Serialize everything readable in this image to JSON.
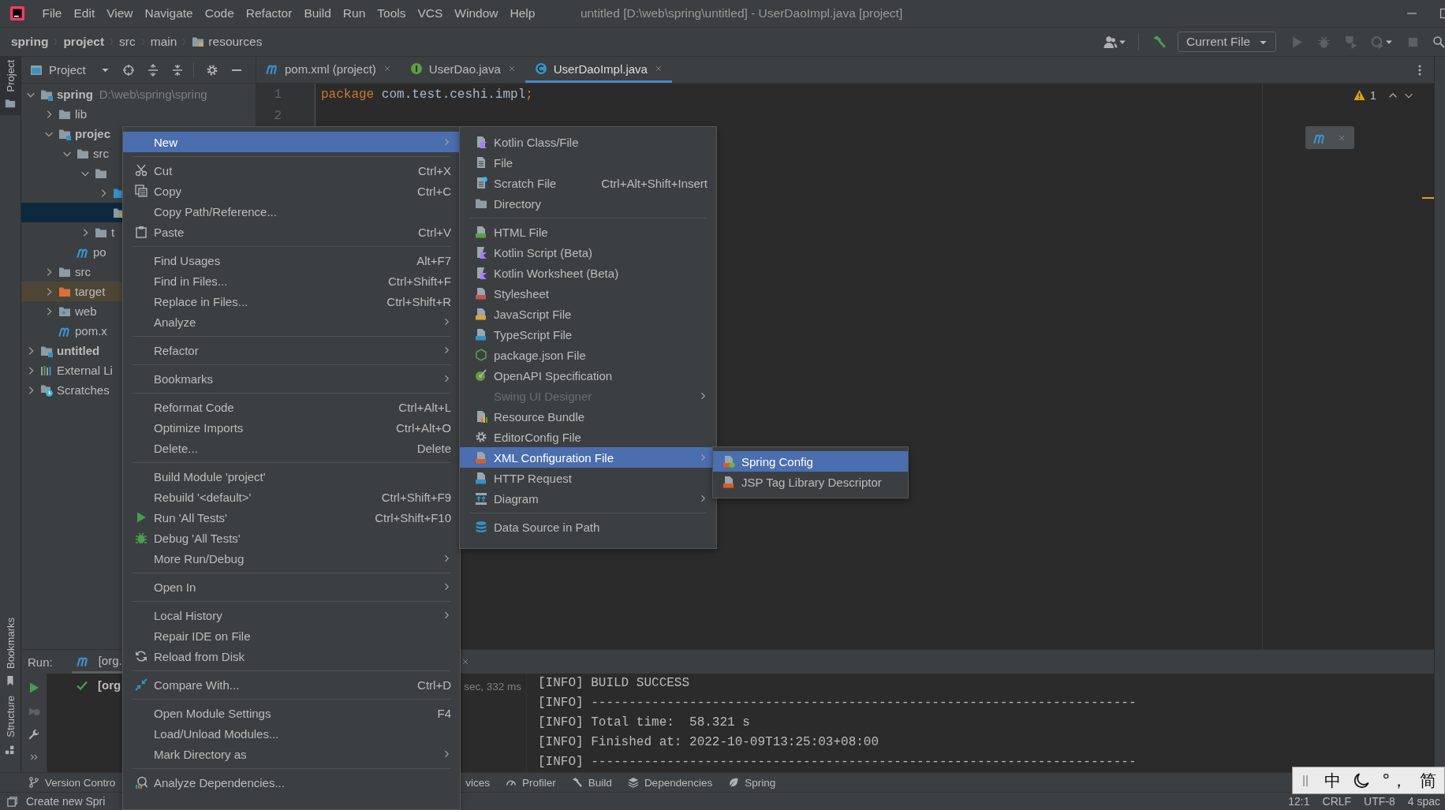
{
  "title_bar": {
    "menus": [
      "File",
      "Edit",
      "View",
      "Navigate",
      "Code",
      "Refactor",
      "Build",
      "Run",
      "Tools",
      "VCS",
      "Window",
      "Help"
    ],
    "title": "untitled [D:\\web\\spring\\untitled] - UserDaoImpl.java [project]"
  },
  "navigation_bar": {
    "breadcrumbs": [
      {
        "text": "spring",
        "bold": true
      },
      {
        "text": "project",
        "bold": true
      },
      {
        "text": "src",
        "bold": false
      },
      {
        "text": "main",
        "bold": false
      },
      {
        "text": "resources",
        "bold": false
      }
    ],
    "run_configuration": "Current File"
  },
  "left_stripe": [
    {
      "label": "Project",
      "selected": true
    },
    {
      "label": "Bookmarks",
      "selected": false
    },
    {
      "label": "Structure",
      "selected": false
    }
  ],
  "project_panel": {
    "title": "Project",
    "tree": [
      {
        "label": "spring",
        "path": "D:\\web\\spring\\spring",
        "kind": "module",
        "expanded": true,
        "selected": false,
        "children": [
          {
            "label": "lib",
            "kind": "folder",
            "expanded": false,
            "selected": false
          },
          {
            "label": "projec",
            "kind": "module",
            "expanded": true,
            "selected": false,
            "children": [
              {
                "label": "src",
                "kind": "folder",
                "expanded": true,
                "selected": false,
                "children": [
                  {
                    "kind": "folder",
                    "expanded": true,
                    "selected": false,
                    "children": [
                      {
                        "kind": "source-folder",
                        "expanded": false,
                        "selected": false
                      },
                      {
                        "kind": "resource-folder",
                        "selected": true
                      }
                    ]
                  },
                  {
                    "label": "t",
                    "kind": "folder",
                    "expanded": false,
                    "selected": false
                  }
                ]
              },
              {
                "label": "po",
                "kind": "maven",
                "selected": false
              }
            ]
          },
          {
            "label": "src",
            "kind": "folder",
            "expanded": false,
            "selected": false
          },
          {
            "label": "target",
            "kind": "excluded-folder",
            "expanded": false,
            "selected": false
          },
          {
            "label": "web",
            "kind": "web-folder",
            "expanded": false,
            "selected": false
          },
          {
            "label": "pom.x",
            "kind": "maven",
            "selected": false
          }
        ]
      },
      {
        "label": "untitled",
        "kind": "module",
        "expanded": false,
        "selected": false
      },
      {
        "label": "External Li",
        "kind": "library",
        "expanded": false,
        "selected": false
      },
      {
        "label": "Scratches",
        "kind": "scratch",
        "expanded": false,
        "selected": false
      }
    ]
  },
  "editor_tabs": [
    {
      "label": "pom.xml (project)",
      "kind": "maven",
      "selected": false
    },
    {
      "label": "UserDao.java",
      "kind": "interface",
      "selected": false
    },
    {
      "label": "UserDaoImpl.java",
      "kind": "class",
      "selected": true
    }
  ],
  "editor": {
    "lines": [
      {
        "number": "1",
        "tokens": [
          {
            "kind": "keyword",
            "text": "package"
          },
          {
            "kind": "plain",
            "text": " com.test.ceshi.impl"
          },
          {
            "kind": "keyword",
            "text": ";"
          }
        ]
      },
      {
        "number": "2"
      }
    ],
    "warnings": "1"
  },
  "run_panel": {
    "label": "Run:",
    "tab": "[org.",
    "tree_item": "[org",
    "duration": "sec, 332 ms",
    "console": [
      "[INFO] BUILD SUCCESS",
      "[INFO] ------------------------------------------------------------------------",
      "[INFO] Total time:  58.321 s",
      "[INFO] Finished at: 2022-10-09T13:25:03+08:00",
      "[INFO] ------------------------------------------------------------------------"
    ]
  },
  "tool_strip": [
    {
      "label": "Version Contro"
    },
    {
      "label": "vices"
    },
    {
      "label": "Profiler"
    },
    {
      "label": "Build"
    },
    {
      "label": "Dependencies"
    },
    {
      "label": "Spring"
    }
  ],
  "status_bar": {
    "message": "Create new Spri",
    "position": "12:1",
    "line_separator": "CRLF",
    "encoding": "UTF-8",
    "indent": "4 spac"
  },
  "context_menu": {
    "items": [
      {
        "kind": "item",
        "label": "New",
        "submenu": true,
        "selected": true
      },
      {
        "kind": "separator"
      },
      {
        "kind": "item",
        "label": "Cut",
        "shortcut": "Ctrl+X",
        "submenu": false,
        "selected": false
      },
      {
        "kind": "item",
        "label": "Copy",
        "shortcut": "Ctrl+C",
        "submenu": false,
        "selected": false
      },
      {
        "kind": "item",
        "label": "Copy Path/Reference...",
        "submenu": false,
        "selected": false
      },
      {
        "kind": "item",
        "label": "Paste",
        "shortcut": "Ctrl+V",
        "submenu": false,
        "selected": false
      },
      {
        "kind": "separator"
      },
      {
        "kind": "item",
        "label": "Find Usages",
        "shortcut": "Alt+F7",
        "submenu": false,
        "selected": false
      },
      {
        "kind": "item",
        "label": "Find in Files...",
        "shortcut": "Ctrl+Shift+F",
        "submenu": false,
        "selected": false
      },
      {
        "kind": "item",
        "label": "Replace in Files...",
        "shortcut": "Ctrl+Shift+R",
        "submenu": false,
        "selected": false
      },
      {
        "kind": "item",
        "label": "Analyze",
        "submenu": true,
        "selected": false
      },
      {
        "kind": "separator"
      },
      {
        "kind": "item",
        "label": "Refactor",
        "submenu": true,
        "selected": false
      },
      {
        "kind": "separator"
      },
      {
        "kind": "item",
        "label": "Bookmarks",
        "submenu": true,
        "selected": false
      },
      {
        "kind": "separator"
      },
      {
        "kind": "item",
        "label": "Reformat Code",
        "shortcut": "Ctrl+Alt+L",
        "submenu": false,
        "selected": false
      },
      {
        "kind": "item",
        "label": "Optimize Imports",
        "shortcut": "Ctrl+Alt+O",
        "submenu": false,
        "selected": false
      },
      {
        "kind": "item",
        "label": "Delete...",
        "shortcut": "Delete",
        "submenu": false,
        "selected": false
      },
      {
        "kind": "separator"
      },
      {
        "kind": "item",
        "label": "Build Module 'project'",
        "submenu": false,
        "selected": false
      },
      {
        "kind": "item",
        "label": "Rebuild '<default>'",
        "shortcut": "Ctrl+Shift+F9",
        "submenu": false,
        "selected": false
      },
      {
        "kind": "item",
        "label": "Run 'All Tests'",
        "shortcut": "Ctrl+Shift+F10",
        "submenu": false,
        "selected": false
      },
      {
        "kind": "item",
        "label": "Debug 'All Tests'",
        "submenu": false,
        "selected": false
      },
      {
        "kind": "item",
        "label": "More Run/Debug",
        "submenu": true,
        "selected": false
      },
      {
        "kind": "separator"
      },
      {
        "kind": "item",
        "label": "Open In",
        "submenu": true,
        "selected": false
      },
      {
        "kind": "separator"
      },
      {
        "kind": "item",
        "label": "Local History",
        "submenu": true,
        "selected": false
      },
      {
        "kind": "item",
        "label": "Repair IDE on File",
        "submenu": false,
        "selected": false
      },
      {
        "kind": "item",
        "label": "Reload from Disk",
        "submenu": false,
        "selected": false
      },
      {
        "kind": "separator"
      },
      {
        "kind": "item",
        "label": "Compare With...",
        "shortcut": "Ctrl+D",
        "submenu": false,
        "selected": false
      },
      {
        "kind": "separator"
      },
      {
        "kind": "item",
        "label": "Open Module Settings",
        "shortcut": "F4",
        "submenu": false,
        "selected": false
      },
      {
        "kind": "item",
        "label": "Load/Unload Modules...",
        "submenu": false,
        "selected": false
      },
      {
        "kind": "item",
        "label": "Mark Directory as",
        "submenu": true,
        "selected": false
      },
      {
        "kind": "separator"
      },
      {
        "kind": "item",
        "label": "Analyze Dependencies...",
        "submenu": false,
        "selected": false
      }
    ]
  },
  "new_submenu": {
    "items": [
      {
        "kind": "item",
        "label": "Kotlin Class/File",
        "submenu": false,
        "selected": false,
        "disabled": false
      },
      {
        "kind": "item",
        "label": "File",
        "submenu": false,
        "selected": false,
        "disabled": false
      },
      {
        "kind": "item",
        "label": "Scratch File",
        "shortcut": "Ctrl+Alt+Shift+Insert",
        "submenu": false,
        "selected": false,
        "disabled": false
      },
      {
        "kind": "item",
        "label": "Directory",
        "submenu": false,
        "selected": false,
        "disabled": false
      },
      {
        "kind": "separator"
      },
      {
        "kind": "item",
        "label": "HTML File",
        "submenu": false,
        "selected": false,
        "disabled": false
      },
      {
        "kind": "item",
        "label": "Kotlin Script (Beta)",
        "submenu": false,
        "selected": false,
        "disabled": false
      },
      {
        "kind": "item",
        "label": "Kotlin Worksheet (Beta)",
        "submenu": false,
        "selected": false,
        "disabled": false
      },
      {
        "kind": "item",
        "label": "Stylesheet",
        "submenu": false,
        "selected": false,
        "disabled": false
      },
      {
        "kind": "item",
        "label": "JavaScript File",
        "submenu": false,
        "selected": false,
        "disabled": false
      },
      {
        "kind": "item",
        "label": "TypeScript File",
        "submenu": false,
        "selected": false,
        "disabled": false
      },
      {
        "kind": "item",
        "label": "package.json File",
        "submenu": false,
        "selected": false,
        "disabled": false
      },
      {
        "kind": "item",
        "label": "OpenAPI Specification",
        "submenu": false,
        "selected": false,
        "disabled": false
      },
      {
        "kind": "item",
        "label": "Swing UI Designer",
        "submenu": true,
        "selected": false,
        "disabled": true
      },
      {
        "kind": "item",
        "label": "Resource Bundle",
        "submenu": false,
        "selected": false,
        "disabled": false
      },
      {
        "kind": "item",
        "label": "EditorConfig File",
        "submenu": false,
        "selected": false,
        "disabled": false
      },
      {
        "kind": "item",
        "label": "XML Configuration File",
        "submenu": true,
        "selected": true,
        "disabled": false
      },
      {
        "kind": "item",
        "label": "HTTP Request",
        "submenu": false,
        "selected": false,
        "disabled": false
      },
      {
        "kind": "item",
        "label": "Diagram",
        "submenu": true,
        "selected": false,
        "disabled": false
      },
      {
        "kind": "separator"
      },
      {
        "kind": "item",
        "label": "Data Source in Path",
        "submenu": false,
        "selected": false,
        "disabled": false
      }
    ]
  },
  "xml_submenu": {
    "items": [
      {
        "kind": "item",
        "label": "Spring Config",
        "submenu": false,
        "selected": true
      },
      {
        "kind": "item",
        "label": "JSP Tag Library Descriptor",
        "submenu": false,
        "selected": false
      }
    ]
  },
  "ime_toolbar": [
    {
      "kind": "handle"
    },
    {
      "kind": "text",
      "text": "中"
    },
    {
      "kind": "moon"
    },
    {
      "kind": "text",
      "text": "°，"
    },
    {
      "kind": "text",
      "text": "简"
    }
  ]
}
